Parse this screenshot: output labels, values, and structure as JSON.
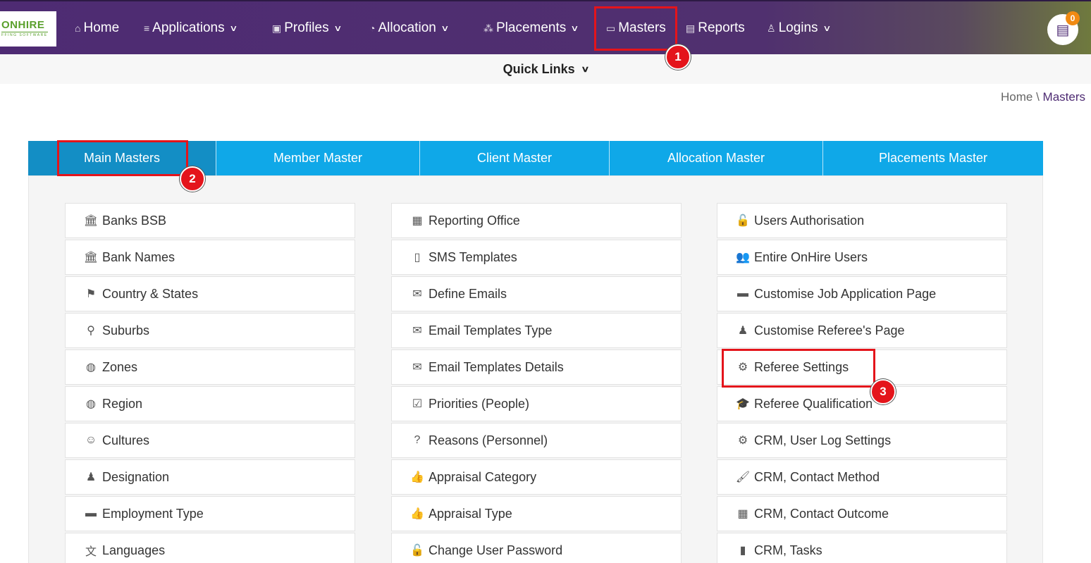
{
  "logo": {
    "main": "ONHIRE",
    "sub": "FFING SOFTWARE"
  },
  "nav": [
    {
      "label": "Home",
      "icon": "home-icon",
      "glyph": "⌂",
      "dropdown": false
    },
    {
      "label": "Applications",
      "icon": "list-icon",
      "glyph": "≡",
      "dropdown": true
    },
    {
      "label": "Profiles",
      "icon": "id-badge-icon",
      "glyph": "▣",
      "dropdown": true
    },
    {
      "label": "Allocation",
      "icon": "pie-chart-icon",
      "glyph": "◔",
      "dropdown": true
    },
    {
      "label": "Placements",
      "icon": "hierarchy-icon",
      "glyph": "⁂",
      "dropdown": true
    },
    {
      "label": "Masters",
      "icon": "folder-icon",
      "glyph": "▭",
      "dropdown": false
    },
    {
      "label": "Reports",
      "icon": "document-icon",
      "glyph": "▤",
      "dropdown": false
    },
    {
      "label": "Logins",
      "icon": "user-icon",
      "glyph": "♙",
      "dropdown": true
    }
  ],
  "notification": {
    "count": "0",
    "icon": "document-icon"
  },
  "quicklinks": {
    "label": "Quick Links"
  },
  "breadcrumb": {
    "home": "Home",
    "separator": " \\ ",
    "current": "Masters"
  },
  "tabs": [
    "Main Masters",
    "Member Master",
    "Client Master",
    "Allocation Master",
    "Placements Master"
  ],
  "active_tab": "Main Masters",
  "columns": [
    [
      {
        "label": "Banks BSB",
        "icon": "bank-icon",
        "glyph": "🏛"
      },
      {
        "label": "Bank Names",
        "icon": "bank-icon",
        "glyph": "🏛"
      },
      {
        "label": "Country & States",
        "icon": "flag-icon",
        "glyph": "⚑"
      },
      {
        "label": "Suburbs",
        "icon": "map-marker-icon",
        "glyph": "⚲"
      },
      {
        "label": "Zones",
        "icon": "globe-icon",
        "glyph": "◍"
      },
      {
        "label": "Region",
        "icon": "globe-icon",
        "glyph": "◍"
      },
      {
        "label": "Cultures",
        "icon": "smile-icon",
        "glyph": "☺"
      },
      {
        "label": "Designation",
        "icon": "user-icon",
        "glyph": "♟"
      },
      {
        "label": "Employment Type",
        "icon": "briefcase-icon",
        "glyph": "▬"
      },
      {
        "label": "Languages",
        "icon": "language-icon",
        "glyph": "文"
      }
    ],
    [
      {
        "label": "Reporting Office",
        "icon": "building-icon",
        "glyph": "▦"
      },
      {
        "label": "SMS Templates",
        "icon": "mobile-icon",
        "glyph": "▯"
      },
      {
        "label": "Define Emails",
        "icon": "envelope-icon",
        "glyph": "✉"
      },
      {
        "label": "Email Templates Type",
        "icon": "envelope-icon",
        "glyph": "✉"
      },
      {
        "label": "Email Templates Details",
        "icon": "envelope-icon",
        "glyph": "✉"
      },
      {
        "label": "Priorities (People)",
        "icon": "check-square-icon",
        "glyph": "☑"
      },
      {
        "label": "Reasons (Personnel)",
        "icon": "question-circle-icon",
        "glyph": "?"
      },
      {
        "label": "Appraisal Category",
        "icon": "thumbs-up-icon",
        "glyph": "👍"
      },
      {
        "label": "Appraisal Type",
        "icon": "thumbs-up-icon",
        "glyph": "👍"
      },
      {
        "label": "Change User Password",
        "icon": "unlock-icon",
        "glyph": "🔓"
      }
    ],
    [
      {
        "label": "Users Authorisation",
        "icon": "unlock-icon",
        "glyph": "🔓"
      },
      {
        "label": "Entire OnHire Users",
        "icon": "users-icon",
        "glyph": "👥"
      },
      {
        "label": "Customise Job Application Page",
        "icon": "briefcase-icon",
        "glyph": "▬"
      },
      {
        "label": "Customise Referee's Page",
        "icon": "user-plus-icon",
        "glyph": "♟"
      },
      {
        "label": "Referee Settings",
        "icon": "cogs-icon",
        "glyph": "⚙"
      },
      {
        "label": "Referee Qualification",
        "icon": "graduation-cap-icon",
        "glyph": "🎓"
      },
      {
        "label": "CRM, User Log Settings",
        "icon": "gear-icon",
        "glyph": "⚙"
      },
      {
        "label": "CRM, Contact Method",
        "icon": "paint-brush-icon",
        "glyph": "🖌"
      },
      {
        "label": "CRM, Contact Outcome",
        "icon": "calendar-icon",
        "glyph": "▦"
      },
      {
        "label": "CRM, Tasks",
        "icon": "file-icon",
        "glyph": "▮"
      }
    ]
  ],
  "annotations": [
    "1",
    "2",
    "3"
  ],
  "colors": {
    "nav_bg": "#4e2b73",
    "tab_bg": "#0fa8e8",
    "tab_active": "#138ec5",
    "highlight": "#e4141b",
    "badge": "#f08a12"
  }
}
